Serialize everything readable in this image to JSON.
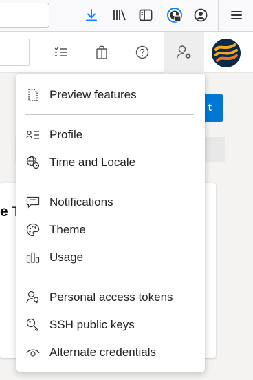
{
  "browser_toolbar": {
    "icons": [
      "download-icon",
      "library-icon",
      "sidebar-icon",
      "password-manager-icon",
      "account-icon",
      "menu-icon"
    ],
    "accent_color": "#0a84ff"
  },
  "app_header": {
    "icons": [
      "task-list-icon",
      "shopping-bag-icon",
      "help-icon",
      "user-settings-icon"
    ],
    "avatar_colors": [
      "#0b2a45",
      "#f5a623",
      "#e8772e"
    ]
  },
  "background_page": {
    "primary_button_partial": "t",
    "card_title_partial": "e T",
    "accent_color": "#0078d4"
  },
  "menu": {
    "sections": [
      {
        "items": [
          {
            "label": "Preview features",
            "icon": "document-icon"
          }
        ]
      },
      {
        "items": [
          {
            "label": "Profile",
            "icon": "contact-card-icon"
          },
          {
            "label": "Time and Locale",
            "icon": "globe-clock-icon"
          }
        ]
      },
      {
        "items": [
          {
            "label": "Notifications",
            "icon": "chat-bubble-icon"
          },
          {
            "label": "Theme",
            "icon": "palette-icon"
          },
          {
            "label": "Usage",
            "icon": "bar-chart-icon"
          }
        ]
      },
      {
        "items": [
          {
            "label": "Personal access tokens",
            "icon": "user-key-icon"
          },
          {
            "label": "SSH public keys",
            "icon": "key-icon"
          },
          {
            "label": "Alternate credentials",
            "icon": "eye-icon"
          }
        ]
      }
    ]
  }
}
